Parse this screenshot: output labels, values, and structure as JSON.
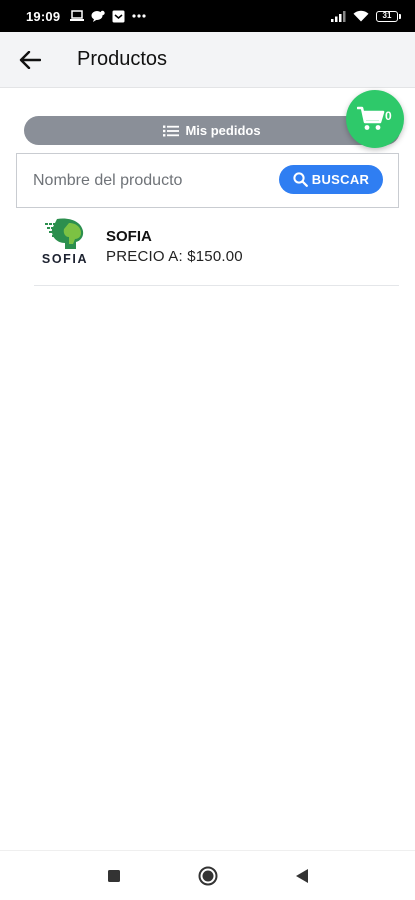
{
  "status_bar": {
    "time": "19:09",
    "left_icons": [
      "laptop-icon",
      "chat-icon",
      "message-icon",
      "more-dots-icon"
    ],
    "right_icons": [
      "signal-icon",
      "wifi-icon",
      "battery-icon"
    ],
    "battery_level": "31"
  },
  "app_bar": {
    "title": "Productos",
    "back_icon": "arrow-left-icon"
  },
  "orders": {
    "label": "Mis pedidos",
    "icon": "list-icon"
  },
  "cart": {
    "count": "0",
    "icon": "shopping-cart-icon",
    "color": "#2ec96a"
  },
  "search": {
    "placeholder": "Nombre del producto",
    "value": "",
    "button_label": "BUSCAR",
    "button_icon": "search-icon",
    "button_color": "#2f7ef2"
  },
  "products": [
    {
      "name": "SOFIA",
      "price": "PRECIO A: $150.00",
      "logo_text": "SOFIA"
    }
  ],
  "nav_bar": {
    "buttons": [
      "recents-square-icon",
      "home-circle-icon",
      "back-triangle-icon"
    ]
  }
}
